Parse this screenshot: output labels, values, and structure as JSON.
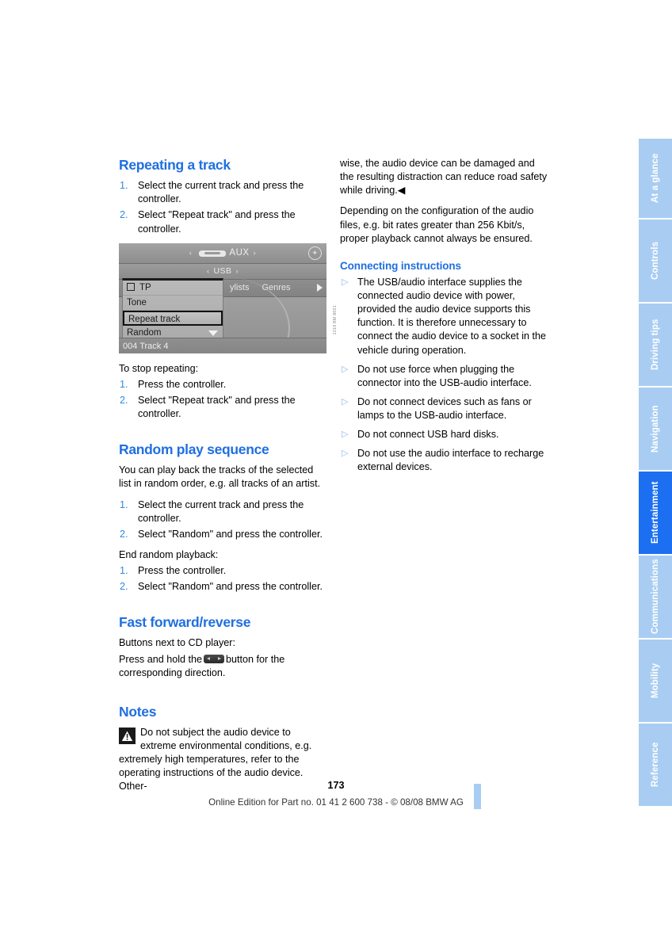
{
  "document": {
    "page_number": "173",
    "footer_note": "Online Edition for Part no. 01 41 2 600 738 - © 08/08 BMW AG"
  },
  "left_column": {
    "section_repeating": {
      "heading": "Repeating a track",
      "steps": [
        {
          "num": "1.",
          "text": "Select the current track and press the controller."
        },
        {
          "num": "2.",
          "text": "Select \"Repeat track\" and press the controller."
        }
      ]
    },
    "figure": {
      "caption_code": "1219 BM 8001",
      "aux_label": "AUX",
      "usb_label": "USB",
      "arrow_left": "‹",
      "arrow_right": "›",
      "tabs": [
        "ylists",
        "Genres"
      ],
      "menu_items": [
        {
          "label": "TP",
          "type": "checkbox",
          "selected": false
        },
        {
          "label": "Tone",
          "type": "plain",
          "selected": false
        },
        {
          "label": "Repeat track",
          "type": "plain",
          "selected": true
        },
        {
          "label": "Random",
          "type": "plain",
          "selected": false
        }
      ],
      "status_text": "004 Track 4"
    },
    "stop_repeating": {
      "intro": "To stop repeating:",
      "steps": [
        {
          "num": "1.",
          "text": "Press the controller."
        },
        {
          "num": "2.",
          "text": "Select \"Repeat track\" and press the controller."
        }
      ]
    },
    "section_random": {
      "heading": "Random play sequence",
      "intro": "You can play back the tracks of the selected list in random order, e.g. all tracks of an artist.",
      "steps": [
        {
          "num": "1.",
          "text": "Select the current track and press the controller."
        },
        {
          "num": "2.",
          "text": "Select \"Random\" and press the controller."
        }
      ],
      "end_intro": "End random playback:",
      "end_steps": [
        {
          "num": "1.",
          "text": "Press the controller."
        },
        {
          "num": "2.",
          "text": "Select \"Random\" and press the controller."
        }
      ]
    },
    "section_fastforward": {
      "heading": "Fast forward/reverse",
      "line1": "Buttons next to CD player:",
      "line2_before": "Press and hold the",
      "line2_after": "button for the corresponding direction."
    },
    "section_notes": {
      "heading": "Notes",
      "warning_text": "Do not subject the audio device to extreme environmental conditions, e.g. extremely high temperatures, refer to the operating instructions of the audio device. Other-"
    }
  },
  "right_column": {
    "continued_warning": "wise, the audio device can be damaged and the resulting distraction can reduce road safety while driving.◀",
    "paragraph": "Depending on the configuration of the audio files, e.g. bit rates greater than 256 Kbit/s, proper playback cannot always be ensured.",
    "section_connecting": {
      "heading": "Connecting instructions",
      "bullets": [
        "The USB/audio interface supplies the connected audio device with power, provided the audio device supports this function. It is therefore unnecessary to connect the audio device to a socket in the vehicle during operation.",
        "Do not use force when plugging the connector into the USB-audio interface.",
        "Do not connect devices such as fans or lamps to the USB-audio interface.",
        "Do not connect USB hard disks.",
        "Do not use the audio interface to recharge external devices."
      ],
      "bullet_glyph": "▷"
    }
  },
  "tabstrip": {
    "tabs": [
      {
        "label": "At a glance",
        "active": false
      },
      {
        "label": "Controls",
        "active": false
      },
      {
        "label": "Driving tips",
        "active": false
      },
      {
        "label": "Navigation",
        "active": false
      },
      {
        "label": "Entertainment",
        "active": true
      },
      {
        "label": "Communications",
        "active": false
      },
      {
        "label": "Mobility",
        "active": false
      },
      {
        "label": "Reference",
        "active": false
      }
    ]
  },
  "colors": {
    "heading_blue": "#1f6fe0",
    "tab_inactive": "#a9cdf2",
    "tab_active": "#1c6ff0",
    "list_number": "#2e8ae5",
    "bullet_triangle": "#8fb8e8"
  }
}
